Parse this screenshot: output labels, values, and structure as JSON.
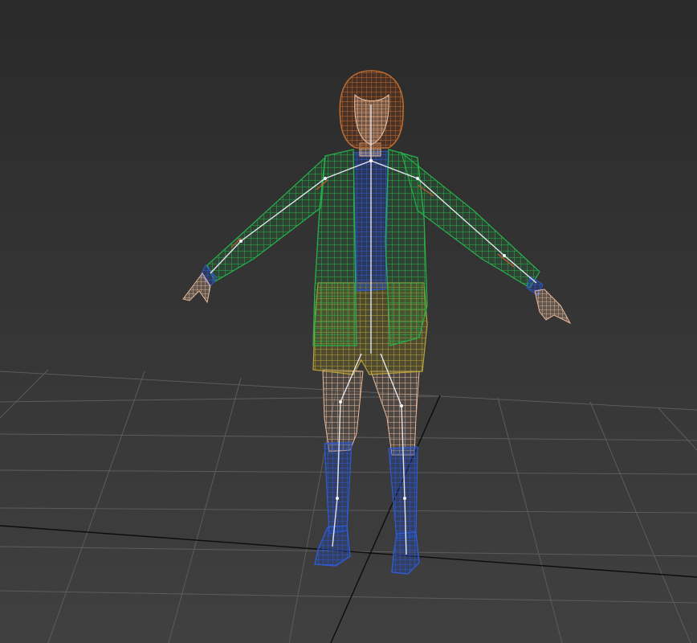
{
  "viewport": {
    "view": "perspective",
    "shading_mode": "wireframe",
    "grid": "visible",
    "background_top": "#2a2a2a",
    "background_bottom": "#3f3f3f",
    "grid_color": "#5a5a5a",
    "world_axis_color": "#0a0a0a"
  },
  "model": {
    "pose": "T-pose",
    "parts": [
      {
        "name": "hair",
        "color": "#9a4a1e",
        "icon": "hair-mesh"
      },
      {
        "name": "skin",
        "color": "#e8b898",
        "icon": "skin-mesh"
      },
      {
        "name": "jacket",
        "color": "#1e8a3a",
        "icon": "jacket-mesh"
      },
      {
        "name": "shirt",
        "color": "#1e44a8",
        "icon": "shirt-mesh"
      },
      {
        "name": "shorts",
        "color": "#a6922a",
        "icon": "shorts-mesh"
      },
      {
        "name": "socks",
        "color": "#1e44a8",
        "icon": "sock-mesh"
      },
      {
        "name": "shoes",
        "color": "#1e44a8",
        "icon": "shoe-mesh"
      },
      {
        "name": "bones",
        "color": "#e0e0ea",
        "icon": "bone-rig"
      }
    ]
  }
}
